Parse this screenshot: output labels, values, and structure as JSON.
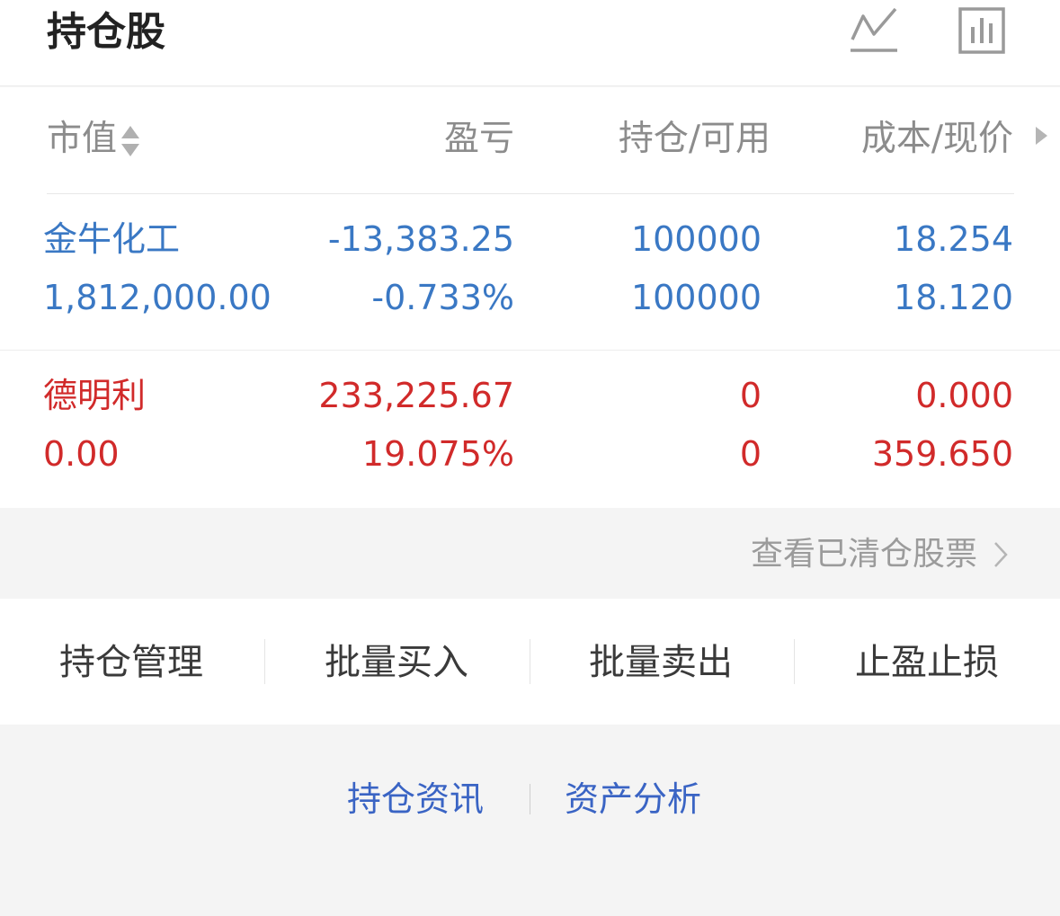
{
  "header": {
    "title": "持仓股",
    "icons": [
      "line-chart-icon",
      "bar-chart-icon"
    ]
  },
  "columns": {
    "market": "市值",
    "pnl": "盈亏",
    "hold": "持仓/可用",
    "cost": "成本/现价"
  },
  "rows": [
    {
      "name": "金牛化工",
      "market_value": "1,812,000.00",
      "pnl": "-13,383.25",
      "pnl_pct": "-0.733%",
      "hold": "100000",
      "available": "100000",
      "cost": "18.254",
      "price": "18.120",
      "color": "#3a78c4"
    },
    {
      "name": "德明利",
      "market_value": "0.00",
      "pnl": "233,225.67",
      "pnl_pct": "19.075%",
      "hold": "0",
      "available": "0",
      "cost": "0.000",
      "price": "359.650",
      "color": "#d12a2a"
    }
  ],
  "cleared_link": "查看已清仓股票",
  "actions": [
    "持仓管理",
    "批量买入",
    "批量卖出",
    "止盈止损"
  ],
  "links": [
    "持仓资讯",
    "资产分析"
  ]
}
